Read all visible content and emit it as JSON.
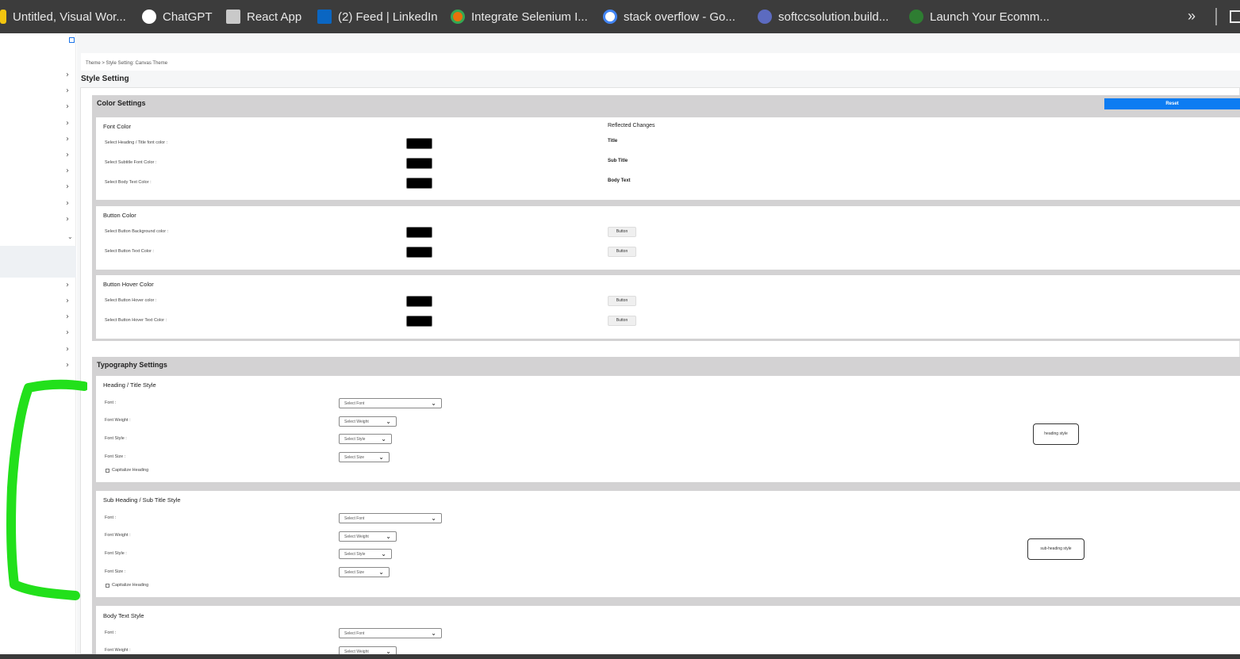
{
  "bookmarks": [
    {
      "label": "Untitled, Visual Wor...",
      "icon": "note-icon",
      "color": "#f1c40f"
    },
    {
      "label": "ChatGPT",
      "icon": "chatgpt-icon",
      "color": "#ffffff"
    },
    {
      "label": "React App",
      "icon": "avatar-icon",
      "color": "#c9c9c9"
    },
    {
      "label": "(2) Feed | LinkedIn",
      "icon": "linkedin-icon",
      "color": "#0a66c2"
    },
    {
      "label": "Integrate Selenium I...",
      "icon": "chrome-icon",
      "color": "#e8710a"
    },
    {
      "label": "stack overflow - Go...",
      "icon": "google-icon",
      "color": "#ffffff"
    },
    {
      "label": "softccsolution.build...",
      "icon": "settings-icon",
      "color": "#5c6bc0"
    },
    {
      "label": "Launch Your Ecomm...",
      "icon": "shop-icon",
      "color": "#2e7d32"
    }
  ],
  "bookmarks_more": "»",
  "breadcrumb": "Theme > Style Setting: Canvas Theme",
  "page_title": "Style Setting",
  "color_settings": {
    "title": "Color Settings",
    "reset_label": "Reset",
    "font_color": {
      "title": "Font Color",
      "reflected_title": "Reflected Changes",
      "rows": [
        {
          "label": "Select Heading / Title font color :",
          "preview": "Title",
          "value": "#000000"
        },
        {
          "label": "Select Subtitle Font Color :",
          "preview": "Sub Title",
          "value": "#000000"
        },
        {
          "label": "Select Body Text Color :",
          "preview": "Body Text",
          "value": "#000000"
        }
      ]
    },
    "button_color": {
      "title": "Button Color",
      "rows": [
        {
          "label": "Select Button Background color :",
          "preview": "Button",
          "value": "#000000"
        },
        {
          "label": "Select Button Text Color :",
          "preview": "Button",
          "value": "#000000"
        }
      ]
    },
    "button_hover_color": {
      "title": "Button Hover Color",
      "rows": [
        {
          "label": "Select Button Hover color :",
          "preview": "Button",
          "value": "#000000"
        },
        {
          "label": "Select Button Hover Text Color :",
          "preview": "Button",
          "value": "#000000"
        }
      ]
    }
  },
  "typography": {
    "title": "Typography Settings",
    "heading": {
      "title": "Heading / Title Style",
      "font_label": "Font :",
      "font_value": "Select Font",
      "weight_label": "Font Weight :",
      "weight_value": "Select Weight",
      "style_label": "Font Style :",
      "style_value": "Select Style",
      "size_label": "Font Size :",
      "size_value": "Select Size",
      "capitalize_label": "Capitalize Heading",
      "preview": "heading style"
    },
    "subheading": {
      "title": "Sub Heading / Sub Title Style",
      "font_label": "Font :",
      "font_value": "Select Font",
      "weight_label": "Font Weight :",
      "weight_value": "Select Weight",
      "style_label": "Font Style :",
      "style_value": "Select Style",
      "size_label": "Font Size :",
      "size_value": "Select Size",
      "capitalize_label": "Capitalize Heading",
      "preview": "sub-heading style"
    },
    "body": {
      "title": "Body Text Style",
      "font_label": "Font :",
      "font_value": "Select Font",
      "weight_label": "Font Weight :",
      "weight_value": "Select Weight"
    }
  },
  "colors": {
    "accent": "#0d7cf2",
    "section_bg": "#d3d2d3",
    "annotation": "#22e01b"
  }
}
